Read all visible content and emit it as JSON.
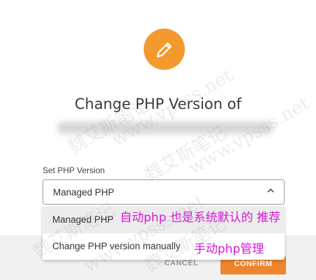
{
  "dialog": {
    "title": "Change PHP Version of",
    "field_label": "Set PHP Version",
    "select": {
      "selected": "Managed PHP",
      "options": [
        "Managed PHP",
        "Change PHP version manually"
      ]
    },
    "buttons": {
      "cancel": "CANCEL",
      "confirm": "CONFIRM"
    }
  },
  "annotations": {
    "auto": "自动php 也是系统默认的 推荐",
    "manual": "手动php管理"
  },
  "watermark": {
    "text1": "魏艾斯笔记",
    "text2": "www.vpsss.net"
  },
  "colors": {
    "accent": "#f3992d",
    "confirm": "#f0842c",
    "annotation": "#d817d8"
  },
  "icons": {
    "header": "pencil-icon",
    "select": "chevron-up-icon"
  }
}
